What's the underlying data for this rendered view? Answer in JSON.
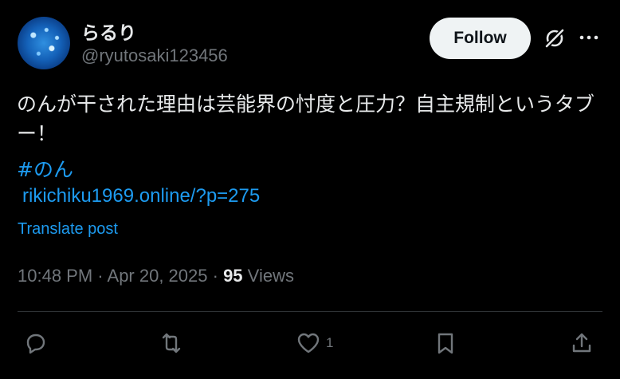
{
  "post": {
    "display_name": "らるり",
    "handle": "@ryutosaki123456",
    "follow_label": "Follow",
    "text": "のんが干された理由は芸能界の忖度と圧力？自主規制というタブー！",
    "hashtag": "#のん",
    "link": "rikichiku1969.online/?p=275",
    "translate_label": "Translate post",
    "time": "10:48 PM",
    "separator": " · ",
    "date": "Apr 20, 2025",
    "views_count": "95",
    "views_label": "Views"
  },
  "actions": {
    "reply_count": "",
    "repost_count": "",
    "like_count": "1",
    "icons": [
      "reply-icon",
      "repost-icon",
      "like-icon",
      "bookmark-icon",
      "share-icon"
    ]
  },
  "colors": {
    "background": "#000000",
    "text": "#e7e9ea",
    "muted": "#71767b",
    "accent": "#1d9bf0",
    "follow_bg": "#eff3f4"
  }
}
